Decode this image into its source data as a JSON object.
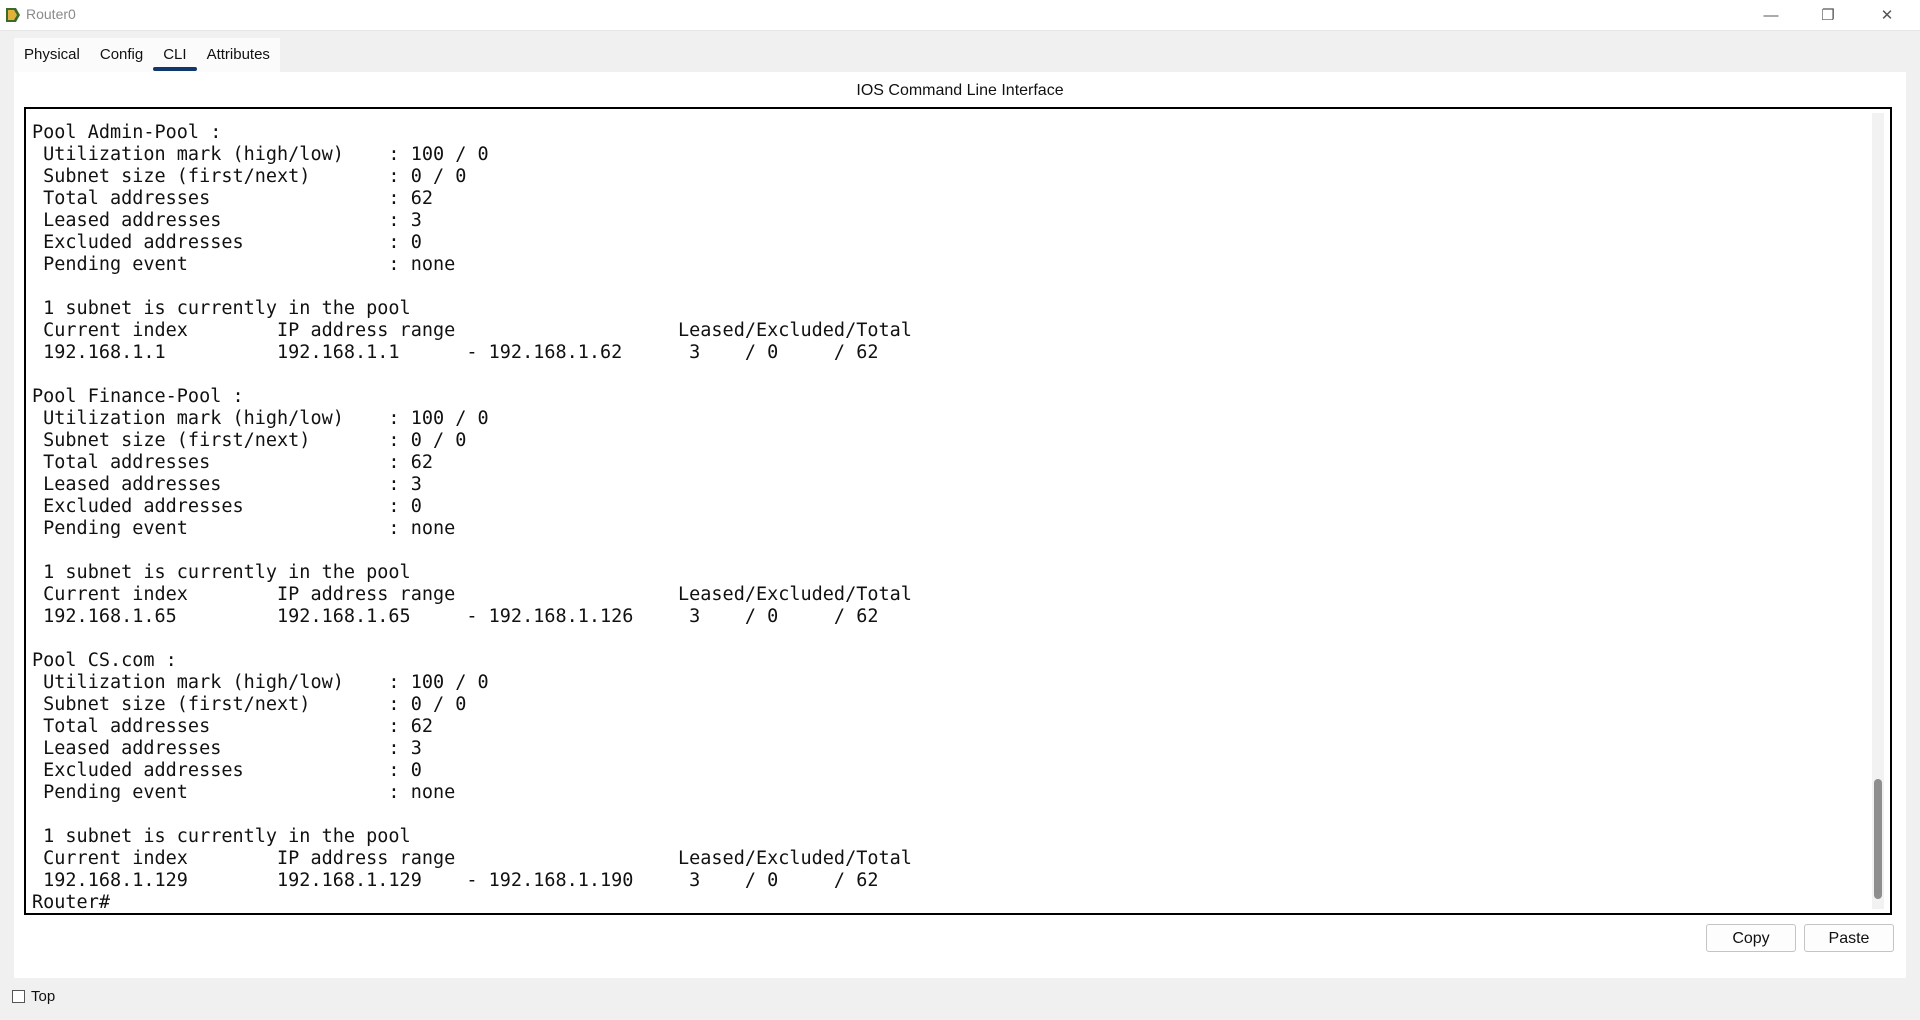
{
  "window": {
    "title": "Router0",
    "minimize_glyph": "—",
    "restore_glyph": "❐",
    "close_glyph": "✕"
  },
  "tabs": [
    {
      "label": "Physical"
    },
    {
      "label": "Config"
    },
    {
      "label": "CLI"
    },
    {
      "label": "Attributes"
    }
  ],
  "active_tab": "CLI",
  "cli": {
    "heading": "IOS Command Line Interface",
    "output": "Pool Admin-Pool :\n Utilization mark (high/low)    : 100 / 0\n Subnet size (first/next)       : 0 / 0\n Total addresses                : 62\n Leased addresses               : 3\n Excluded addresses             : 0\n Pending event                  : none\n\n 1 subnet is currently in the pool\n Current index        IP address range                    Leased/Excluded/Total\n 192.168.1.1          192.168.1.1      - 192.168.1.62      3    / 0     / 62\n\nPool Finance-Pool :\n Utilization mark (high/low)    : 100 / 0\n Subnet size (first/next)       : 0 / 0\n Total addresses                : 62\n Leased addresses               : 3\n Excluded addresses             : 0\n Pending event                  : none\n\n 1 subnet is currently in the pool\n Current index        IP address range                    Leased/Excluded/Total\n 192.168.1.65         192.168.1.65     - 192.168.1.126     3    / 0     / 62\n\nPool CS.com :\n Utilization mark (high/low)    : 100 / 0\n Subnet size (first/next)       : 0 / 0\n Total addresses                : 62\n Leased addresses               : 3\n Excluded addresses             : 0\n Pending event                  : none\n\n 1 subnet is currently in the pool\n Current index        IP address range                    Leased/Excluded/Total\n 192.168.1.129        192.168.1.129    - 192.168.1.190     3    / 0     / 62\nRouter#"
  },
  "buttons": {
    "copy": "Copy",
    "paste": "Paste"
  },
  "top_checkbox": {
    "label": "Top",
    "checked": false
  },
  "colors": {
    "active_tab_indicator": "#12376a"
  }
}
